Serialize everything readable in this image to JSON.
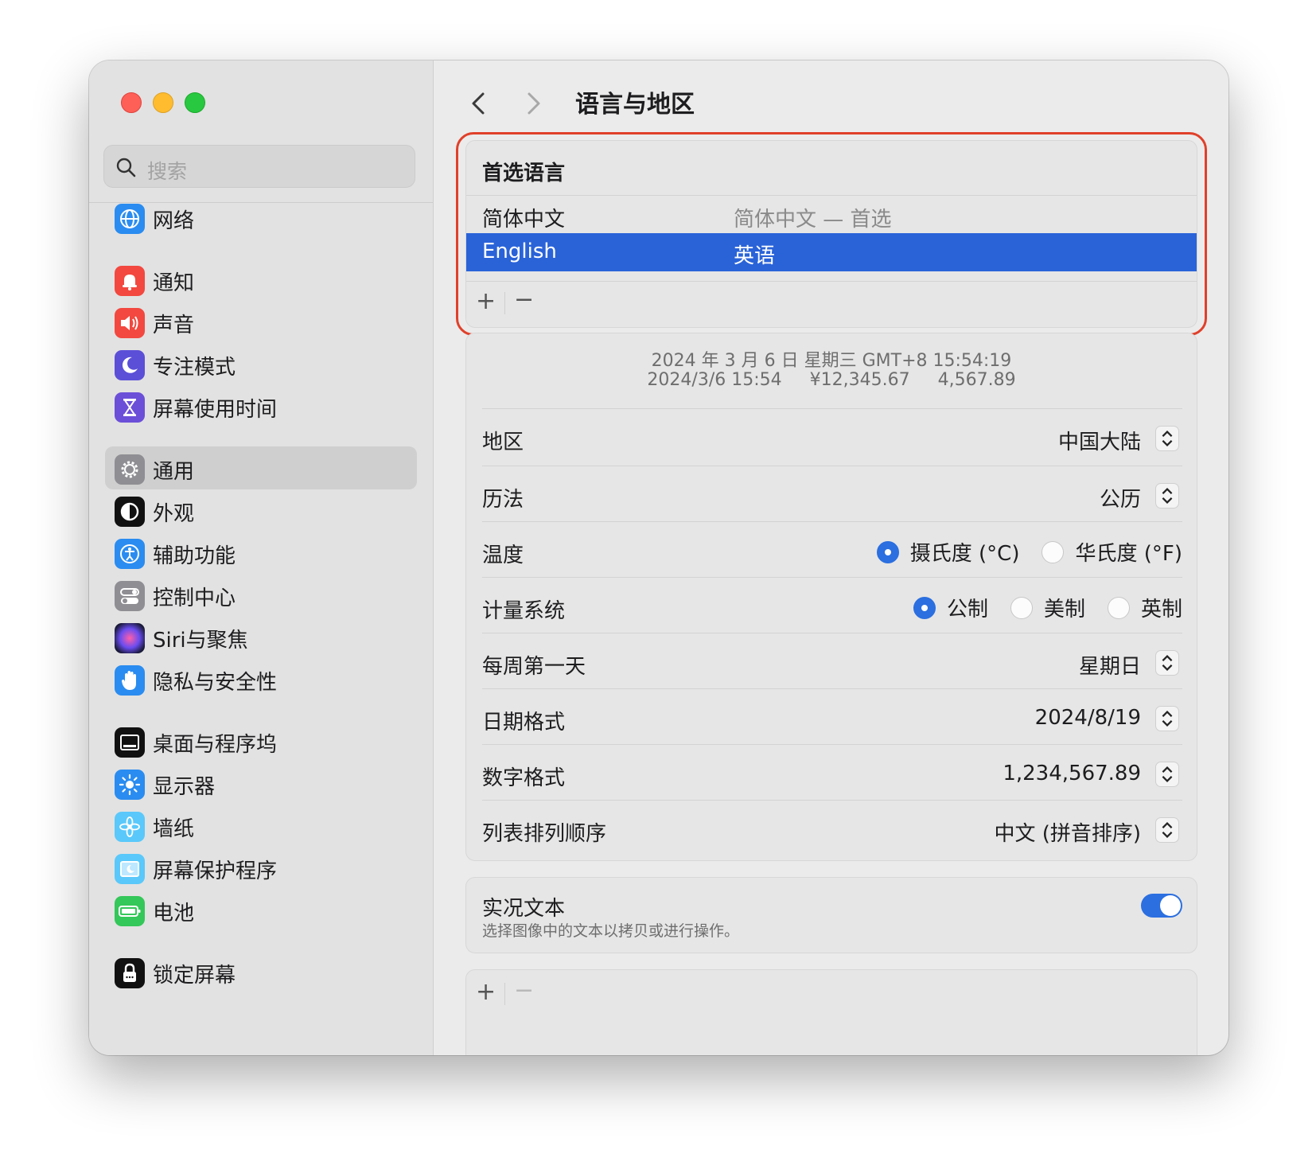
{
  "window": {
    "title": "语言与地区"
  },
  "sidebar": {
    "search_placeholder": "搜索",
    "items": [
      {
        "label": "网络",
        "icon": "globe-icon",
        "color": "#2a8cf0"
      },
      {
        "label": "通知",
        "icon": "bell-icon",
        "color": "#f2483f"
      },
      {
        "label": "声音",
        "icon": "speaker-icon",
        "color": "#f2483f"
      },
      {
        "label": "专注模式",
        "icon": "moon-icon",
        "color": "#5b4fd8"
      },
      {
        "label": "屏幕使用时间",
        "icon": "hourglass-icon",
        "color": "#6b4fd8"
      },
      {
        "label": "通用",
        "icon": "gear-icon",
        "color": "#8e8e93"
      },
      {
        "label": "外观",
        "icon": "appearance-icon",
        "color": "#111111"
      },
      {
        "label": "辅助功能",
        "icon": "accessibility-icon",
        "color": "#2a8cf0"
      },
      {
        "label": "控制中心",
        "icon": "switches-icon",
        "color": "#8e8e93"
      },
      {
        "label": "Siri与聚焦",
        "icon": "siri-icon",
        "color": "#3a2f7a"
      },
      {
        "label": "隐私与安全性",
        "icon": "hand-icon",
        "color": "#2a8cf0"
      },
      {
        "label": "桌面与程序坞",
        "icon": "dock-icon",
        "color": "#111111"
      },
      {
        "label": "显示器",
        "icon": "sun-icon",
        "color": "#2a8cf0"
      },
      {
        "label": "墙纸",
        "icon": "flower-icon",
        "color": "#5ac8fa"
      },
      {
        "label": "屏幕保护程序",
        "icon": "screensaver-icon",
        "color": "#5ac8fa"
      },
      {
        "label": "电池",
        "icon": "battery-icon",
        "color": "#34c759"
      },
      {
        "label": "锁定屏幕",
        "icon": "lock-icon",
        "color": "#111111"
      }
    ]
  },
  "preferred_languages": {
    "title": "首选语言",
    "rows": [
      {
        "name": "简体中文",
        "detail": "简体中文 — 首选"
      },
      {
        "name": "English",
        "detail": "英语"
      }
    ],
    "add_label": "+",
    "remove_label": "−"
  },
  "preview": {
    "line1": "2024 年 3 月 6 日 星期三 GMT+8 15:54:19",
    "date": "2024/3/6 15:54",
    "currency": "¥12,345.67",
    "number": "4,567.89"
  },
  "settings": {
    "region": {
      "label": "地区",
      "value": "中国大陆"
    },
    "calendar": {
      "label": "历法",
      "value": "公历"
    },
    "temperature": {
      "label": "温度",
      "options": [
        "摄氏度 (°C)",
        "华氏度 (°F)"
      ],
      "selected": 0
    },
    "measurement": {
      "label": "计量系统",
      "options": [
        "公制",
        "美制",
        "英制"
      ],
      "selected": 0
    },
    "first_day": {
      "label": "每周第一天",
      "value": "星期日"
    },
    "date_format": {
      "label": "日期格式",
      "value": "2024/8/19"
    },
    "number_format": {
      "label": "数字格式",
      "value": "1,234,567.89"
    },
    "list_sort": {
      "label": "列表排列顺序",
      "value": "中文 (拼音排序)"
    }
  },
  "live_text": {
    "title": "实况文本",
    "subtitle": "选择图像中的文本以拷贝或进行操作。",
    "enabled": true
  },
  "bottom_bar": {
    "add_label": "+",
    "remove_label": "−"
  },
  "colors": {
    "accent": "#2b6fe0",
    "selection": "#2a63d8",
    "highlight_border": "#e0402a"
  }
}
